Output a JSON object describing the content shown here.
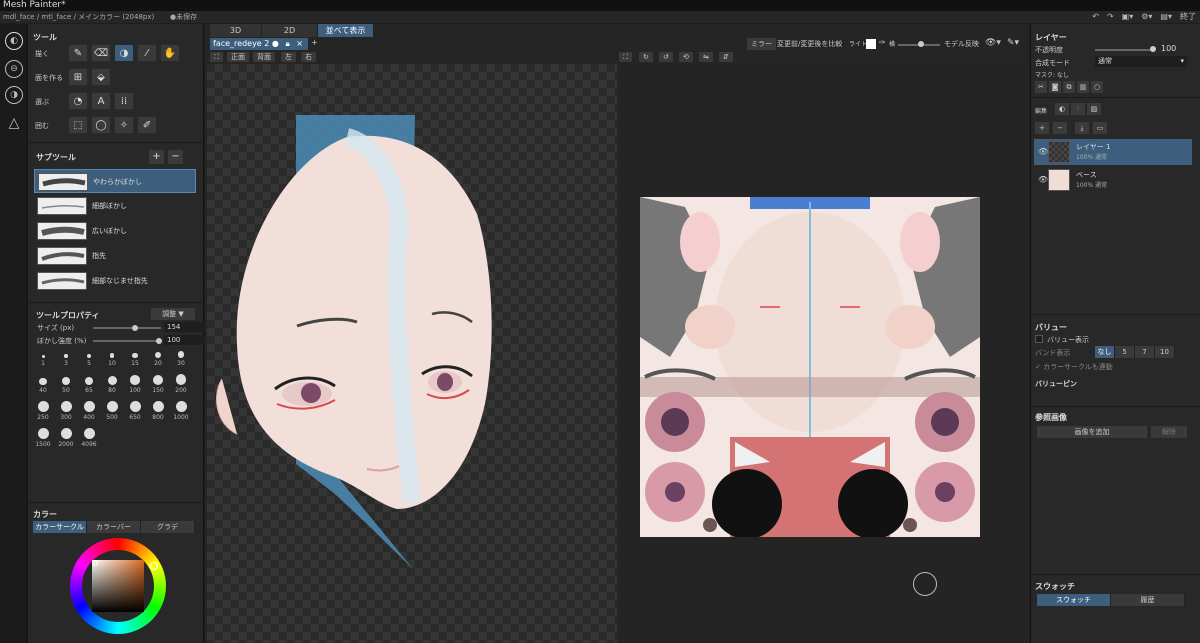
{
  "window": {
    "title": "Mesh Painter*",
    "path": "mdl_face / mtl_face / メインカラー (2048px)",
    "unsaved": "●未保存",
    "end_label": "終了"
  },
  "left": {
    "tools_title": "ツール",
    "groups": [
      "描く",
      "面を作る",
      "選ぶ",
      "囲む"
    ],
    "subtools_title": "サブツール",
    "subtools": [
      "やわらかぼかし",
      "細部ぼかし",
      "広いぼかし",
      "指先",
      "細部なじませ指先"
    ],
    "props_title": "ツールプロパティ",
    "adjust_label": "調整 ▼",
    "size_label": "サイズ (px)",
    "size_value": "154",
    "blur_label": "ぼかし強度 (%)",
    "blur_value": "100",
    "brush_sizes": [
      "1",
      "3",
      "5",
      "10",
      "15",
      "20",
      "30",
      "40",
      "50",
      "65",
      "80",
      "100",
      "150",
      "200",
      "250",
      "300",
      "400",
      "500",
      "650",
      "800",
      "1000",
      "1500",
      "2000",
      "4096"
    ],
    "color_title": "カラー",
    "color_tabs": [
      "カラーサークル",
      "カラーバー",
      "グラデ"
    ]
  },
  "center": {
    "view_tabs": [
      "3D",
      "2D",
      "並べて表示"
    ],
    "file_tab": "face_redeye 2",
    "file_tab_plus": "+",
    "view_buttons": [
      "正面",
      "背面",
      "左",
      "右"
    ],
    "mirror": "ミラー",
    "compare": "変更前/変更後を比較",
    "light": "ライト",
    "side": "横",
    "model_flip": "モデル反映"
  },
  "right": {
    "layer_title": "レイヤー",
    "opacity_label": "不透明度",
    "opacity_value": "100",
    "blend_label": "合成モード",
    "blend_value": "通常",
    "mask_label": "マスク: なし",
    "edit_label": "編集",
    "layers": [
      {
        "name": "レイヤー 1",
        "sub": "100% 通常"
      },
      {
        "name": "ベース",
        "sub": "100% 通常"
      }
    ],
    "value_title": "バリュー",
    "value_show": "バリュー表示",
    "band_label": "バンド表示",
    "band_opts": [
      "なし",
      "5",
      "7",
      "10"
    ],
    "circle_link": "カラーサークルも連動",
    "value_pin": "バリューピン",
    "ref_title": "参照画像",
    "add_image": "画像を追加",
    "release": "解除",
    "swatch_title": "スウォッチ",
    "swatch_tabs": [
      "スウォッチ",
      "履歴"
    ]
  },
  "colors": {
    "accent": "#3d5f7d",
    "panel": "#282828",
    "bg": "#1e1e1e"
  }
}
